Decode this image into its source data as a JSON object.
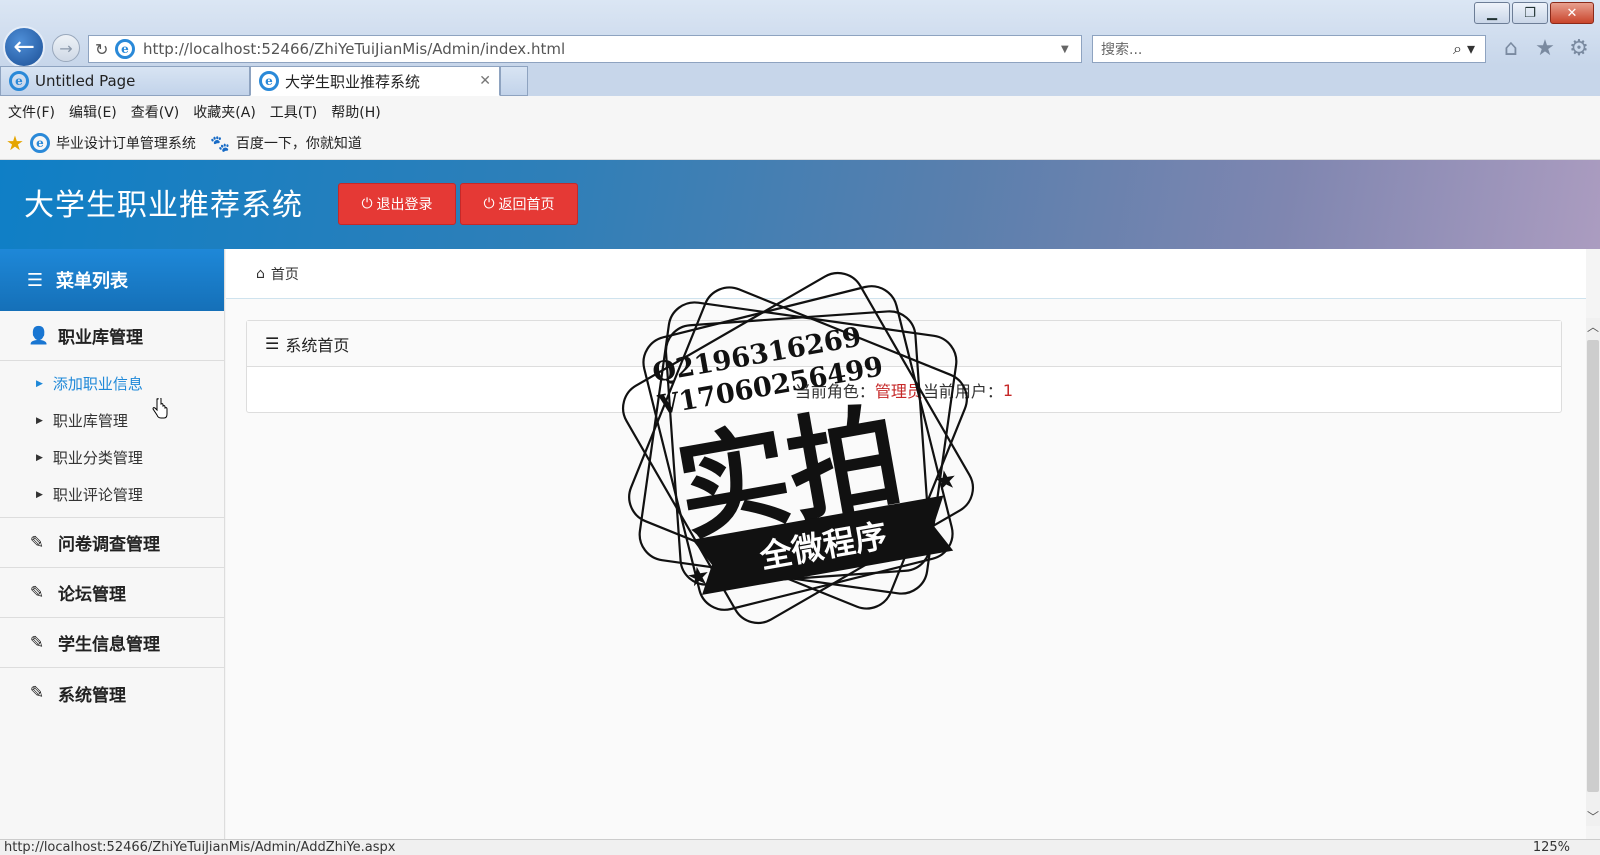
{
  "browser": {
    "address": "http://localhost:52466/ZhiYeTuiJianMis/Admin/index.html",
    "search_placeholder": "搜索...",
    "tabs": [
      {
        "label": "Untitled Page"
      },
      {
        "label": "大学生职业推荐系统"
      }
    ],
    "menu": [
      "文件(F)",
      "编辑(E)",
      "查看(V)",
      "收藏夹(A)",
      "工具(T)",
      "帮助(H)"
    ],
    "favorites": [
      "毕业设计订单管理系统",
      "百度一下，你就知道"
    ],
    "status_url": "http://localhost:52466/ZhiYeTuiJianMis/Admin/AddZhiYe.aspx",
    "zoom": "125%"
  },
  "app": {
    "title": "大学生职业推荐系统",
    "logout_label": "退出登录",
    "home_label": "返回首页"
  },
  "sidebar": {
    "header": "菜单列表",
    "group1": "职业库管理",
    "subitems": [
      "添加职业信息",
      "职业库管理",
      "职业分类管理",
      "职业评论管理"
    ],
    "groups": [
      "问卷调查管理",
      "论坛管理",
      "学生信息管理",
      "系统管理"
    ]
  },
  "main": {
    "breadcrumb": "首页",
    "panel_title": "系统首页",
    "role_label": "当前角色：",
    "role_value": "管理员",
    "user_label": "当前用户：",
    "user_value": "1"
  },
  "stamp": {
    "line1": "Q2196316269",
    "line2": "V17060256499",
    "big": "实拍",
    "ribbon": "全微程序"
  }
}
